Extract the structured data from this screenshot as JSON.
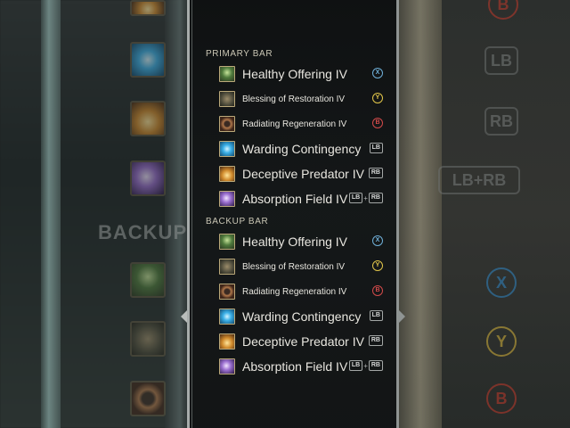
{
  "panel": {
    "primary_header": "PRIMARY BAR",
    "backup_header": "BACKUP BAR",
    "primary_skills": [
      {
        "name": "Healthy Offering IV",
        "size": "large",
        "icon": "healthy-offering-icon",
        "button": "X",
        "button_color": "#6fb0d8"
      },
      {
        "name": "Blessing of Restoration IV",
        "size": "small",
        "icon": "blessing-of-restoration-icon",
        "button": "Y",
        "button_color": "#e2c64a"
      },
      {
        "name": "Radiating Regeneration IV",
        "size": "small",
        "icon": "radiating-regeneration-icon",
        "button": "B",
        "button_color": "#d24a4a"
      },
      {
        "name": "Warding Contingency",
        "size": "large",
        "icon": "warding-contingency-icon",
        "button": "LB"
      },
      {
        "name": "Deceptive Predator IV",
        "size": "large",
        "icon": "deceptive-predator-icon",
        "button": "RB"
      },
      {
        "name": "Absorption Field IV",
        "size": "large",
        "icon": "absorption-field-icon",
        "button": "LB+RB"
      }
    ],
    "backup_skills": [
      {
        "name": "Healthy Offering IV",
        "size": "large",
        "icon": "healthy-offering-icon",
        "button": "X",
        "button_color": "#6fb0d8"
      },
      {
        "name": "Blessing of Restoration IV",
        "size": "small",
        "icon": "blessing-of-restoration-icon",
        "button": "Y",
        "button_color": "#e2c64a"
      },
      {
        "name": "Radiating Regeneration IV",
        "size": "small",
        "icon": "radiating-regeneration-icon",
        "button": "B",
        "button_color": "#d24a4a"
      },
      {
        "name": "Warding Contingency",
        "size": "large",
        "icon": "warding-contingency-icon",
        "button": "LB"
      },
      {
        "name": "Deceptive Predator IV",
        "size": "large",
        "icon": "deceptive-predator-icon",
        "button": "RB"
      },
      {
        "name": "Absorption Field IV",
        "size": "large",
        "icon": "absorption-field-icon",
        "button": "LB+RB"
      }
    ]
  },
  "background": {
    "left_label": "BACKUP",
    "right_buttons": [
      "LB",
      "RB",
      "LB+RB"
    ],
    "right_face_buttons": [
      {
        "label": "B",
        "color": "#c0392b"
      },
      {
        "label": "X",
        "color": "#2f86c4"
      },
      {
        "label": "Y",
        "color": "#d4b23a"
      },
      {
        "label": "B",
        "color": "#c0392b"
      }
    ]
  },
  "buttons": {
    "lb": "LB",
    "rb": "RB",
    "plus": "+"
  }
}
